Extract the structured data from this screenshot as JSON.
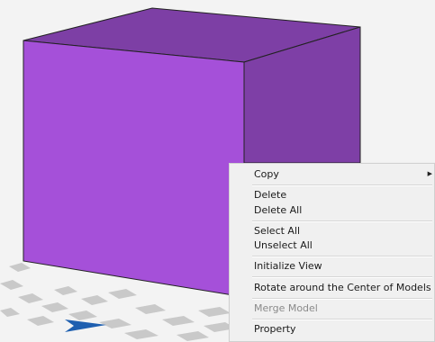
{
  "context_menu": {
    "items": [
      {
        "label": "Copy",
        "has_submenu": true,
        "enabled": true
      },
      {
        "label": "Delete",
        "enabled": true
      },
      {
        "label": "Delete All",
        "enabled": true
      },
      {
        "label": "Select All",
        "enabled": true
      },
      {
        "label": "Unselect All",
        "enabled": true
      },
      {
        "label": "Initialize View",
        "enabled": true
      },
      {
        "label": "Rotate around the Center of Models",
        "enabled": true
      },
      {
        "label": "Merge Model",
        "enabled": false
      },
      {
        "label": "Property",
        "enabled": true
      }
    ]
  },
  "scene": {
    "background_color": "#f3f3f3",
    "model_front_color": "#a550d9",
    "model_top_color": "#7d3fa5",
    "model_side_color": "#7e3fa6",
    "model_edge_color": "#222222",
    "floor_tile_color": "#c9c9c9",
    "axis_color": "#1e5fb0"
  }
}
